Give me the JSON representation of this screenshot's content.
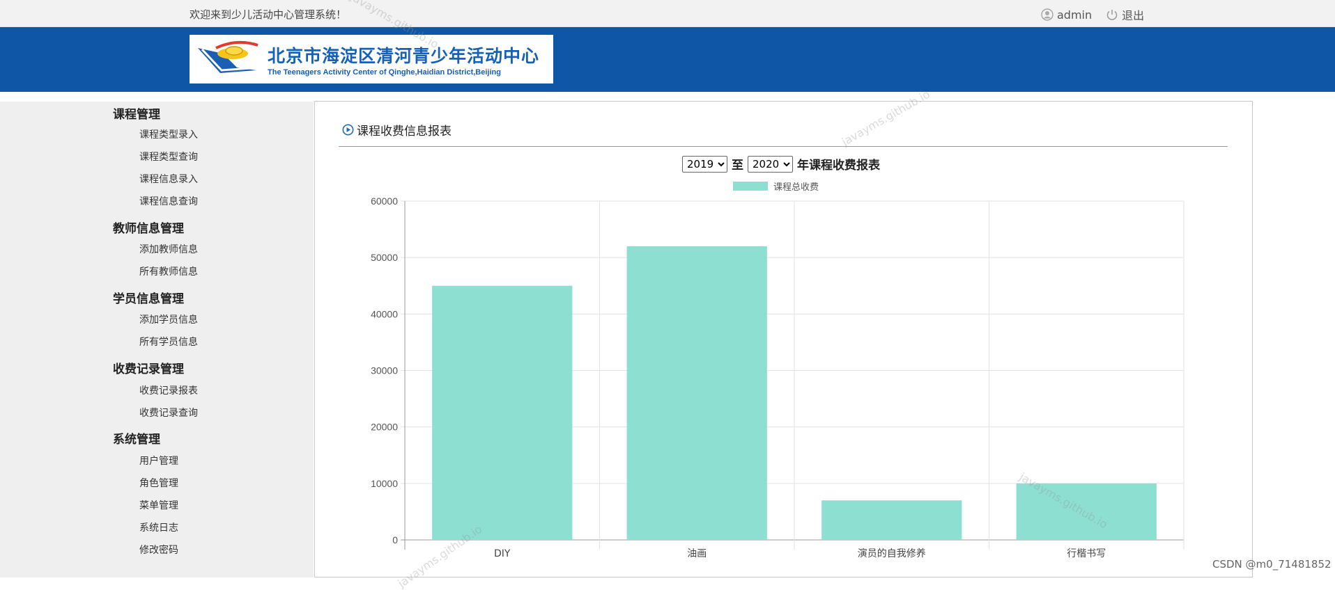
{
  "topbar": {
    "welcome": "欢迎来到少儿活动中心管理系统！",
    "username": "admin",
    "logout": "退出"
  },
  "banner": {
    "title_cn": "北京市海淀区清河青少年活动中心",
    "title_en": "The Teenagers Activity Center of Qinghe,Haidian District,Beijing"
  },
  "sidebar": {
    "groups": [
      {
        "title": "课程管理",
        "items": [
          "课程类型录入",
          "课程类型查询",
          "课程信息录入",
          "课程信息查询"
        ]
      },
      {
        "title": "教师信息管理",
        "items": [
          "添加教师信息",
          "所有教师信息"
        ]
      },
      {
        "title": "学员信息管理",
        "items": [
          "添加学员信息",
          "所有学员信息"
        ]
      },
      {
        "title": "收费记录管理",
        "items": [
          "收费记录报表",
          "收费记录查询"
        ]
      },
      {
        "title": "系统管理",
        "items": [
          "用户管理",
          "角色管理",
          "菜单管理",
          "系统日志",
          "修改密码"
        ]
      }
    ]
  },
  "main": {
    "panel_title": "课程收费信息报表",
    "start_year": "2019",
    "to_label": "至",
    "end_year": "2020",
    "report_suffix": "年课程收费报表"
  },
  "chart_data": {
    "type": "bar",
    "categories": [
      "DIY",
      "油画",
      "演员的自我修养",
      "行楷书写"
    ],
    "series": [
      {
        "name": "课程总收费",
        "values": [
          45000,
          52000,
          7000,
          10000
        ]
      }
    ],
    "ylim": [
      0,
      60000
    ],
    "yticks": [
      0,
      10000,
      20000,
      30000,
      40000,
      50000,
      60000
    ],
    "grid": true,
    "legend": "top-center",
    "bar_color": "#8ddfd2"
  },
  "watermarks": [
    "javayms.github.io",
    "javayms.github.io",
    "javayms.github.io",
    "javayms.github.io"
  ],
  "footer": {
    "csdn": "CSDN @m0_71481852"
  }
}
